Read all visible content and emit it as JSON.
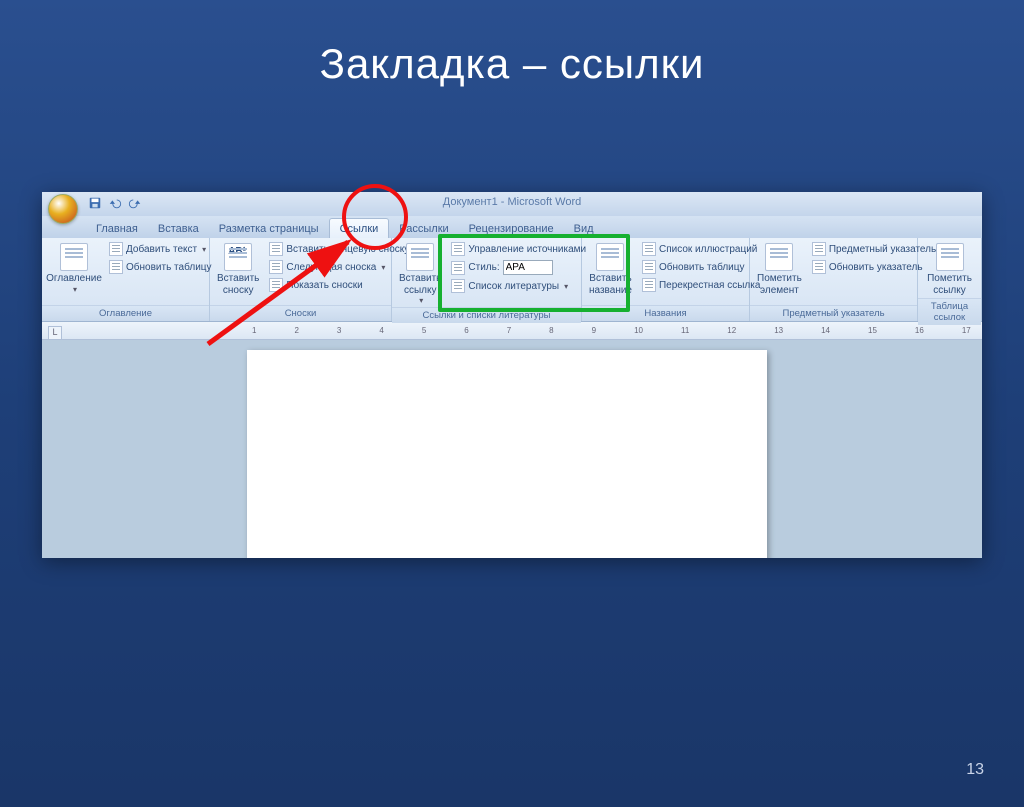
{
  "slide": {
    "title": "Закладка – ссылки",
    "page_number": "13"
  },
  "word": {
    "doc_title": "Документ1 - Microsoft Word",
    "tabs": [
      "Главная",
      "Вставка",
      "Разметка страницы",
      "Ссылки",
      "Рассылки",
      "Рецензирование",
      "Вид"
    ],
    "active_tab_index": 3,
    "groups": {
      "toc": {
        "label": "Оглавление",
        "big": "Оглавление",
        "items": [
          "Добавить текст",
          "Обновить таблицу"
        ]
      },
      "footnotes": {
        "label": "Сноски",
        "big": "Вставить сноску",
        "items": [
          "Вставить концевую сноску",
          "Следующая сноска",
          "Показать сноски"
        ]
      },
      "citations": {
        "label": "Ссылки и списки литературы",
        "big": "Вставить ссылку",
        "manage": "Управление источниками",
        "style_lbl": "Стиль:",
        "style_val": "APA",
        "bibliography": "Список литературы"
      },
      "captions": {
        "label": "Названия",
        "big": "Вставить название",
        "items": [
          "Список иллюстраций",
          "Обновить таблицу",
          "Перекрестная ссылка"
        ]
      },
      "index": {
        "label": "Предметный указатель",
        "big": "Пометить элемент",
        "items": [
          "Предметный указатель",
          "Обновить указатель"
        ]
      },
      "toa": {
        "label": "Таблица ссылок",
        "big": "Пометить ссылку"
      }
    },
    "ruler_marks": [
      "1",
      "2",
      "3",
      "4",
      "5",
      "6",
      "7",
      "8",
      "9",
      "10",
      "11",
      "12",
      "13",
      "14",
      "15",
      "16",
      "17"
    ]
  }
}
